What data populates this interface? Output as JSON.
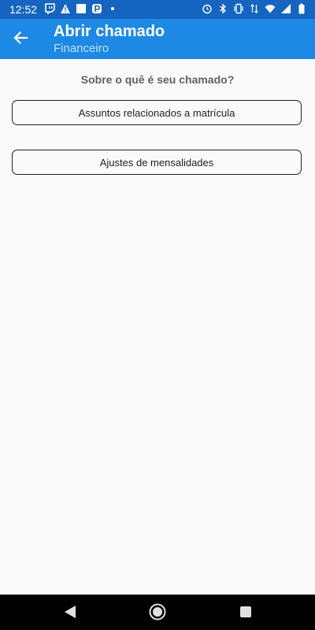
{
  "status_bar": {
    "time": "12:52",
    "left_icons": [
      "twitch-icon",
      "warning-icon",
      "square-icon",
      "parking-icon",
      "dot-icon"
    ],
    "right_icons": [
      "alarm-icon",
      "bluetooth-icon",
      "vibrate-icon",
      "data-arrows-icon",
      "wifi-icon",
      "signal-icon",
      "battery-icon"
    ]
  },
  "app_bar": {
    "title": "Abrir chamado",
    "subtitle": "Financeiro",
    "back_icon": "arrow-back-icon",
    "color": "#1e88e5"
  },
  "content": {
    "question": "Sobre o quê é seu chamado?",
    "options": [
      {
        "label": "Assuntos relacionados a matrícula"
      },
      {
        "label": "Ajustes de mensalidades"
      }
    ]
  },
  "nav_bar": {
    "icons": [
      "nav-back-icon",
      "nav-home-icon",
      "nav-recents-icon"
    ]
  }
}
